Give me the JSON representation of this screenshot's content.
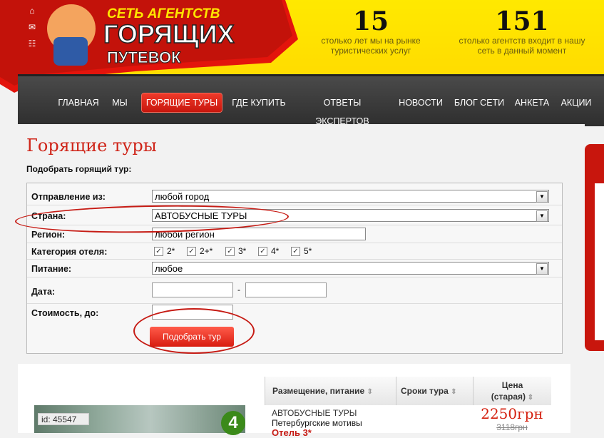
{
  "header": {
    "brand_line1": "СЕТЬ АГЕНТСТВ",
    "brand_line2": "ГОРЯЩИХ",
    "brand_line3": "ПУТЕВОК",
    "stats": [
      {
        "value": "15",
        "caption1": "столько лет мы на рынке",
        "caption2": "туристических услуг"
      },
      {
        "value": "151",
        "caption1": "столько агентств входит в нашу",
        "caption2": "сеть в данный момент"
      }
    ]
  },
  "nav": {
    "items": [
      "ГЛАВНАЯ",
      "МЫ",
      "ГОРЯЩИЕ ТУРЫ",
      "ГДЕ КУПИТЬ",
      "ОТВЕТЫ ЭКСПЕРТОВ",
      "НОВОСТИ",
      "БЛОГ СЕТИ",
      "АНКЕТА",
      "АКЦИИ"
    ],
    "active": "ГОРЯЩИЕ ТУРЫ"
  },
  "page": {
    "title": "Горящие туры",
    "subtitle": "Подобрать горящий тур:"
  },
  "form": {
    "departure_label": "Отправление из:",
    "departure_value": "любой город",
    "country_label": "Страна:",
    "country_value": "АВТОБУСНЫЕ ТУРЫ",
    "region_label": "Регион:",
    "region_value": "любой регион",
    "hotel_label": "Категория отеля:",
    "hotel_categories": [
      "2*",
      "2+*",
      "3*",
      "4*",
      "5*"
    ],
    "food_label": "Питание:",
    "food_value": "любое",
    "date_label": "Дата:",
    "date_sep": "-",
    "cost_label": "Стоимость, до:",
    "submit_label": "Подобрать тур"
  },
  "results": {
    "col_placement": "Размещение, питание",
    "col_dates": "Сроки тура",
    "col_price1": "Цена",
    "col_price2": "(старая)",
    "row": {
      "id": "id: 45547",
      "badge": "4",
      "type": "АВТОБУСНЫЕ ТУРЫ",
      "name": "Петербургские мотивы",
      "hotel": "Отель 3*",
      "price": "2250грн",
      "old_price": "3118грн"
    }
  }
}
